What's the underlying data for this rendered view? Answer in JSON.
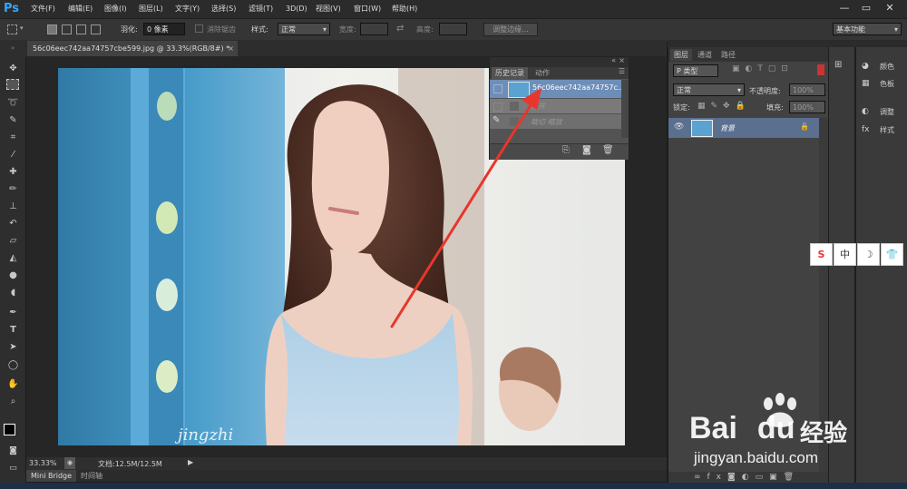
{
  "app": {
    "logo": "Ps"
  },
  "menu": [
    "文件(F)",
    "编辑(E)",
    "图像(I)",
    "图层(L)",
    "文字(Y)",
    "选择(S)",
    "滤镜(T)",
    "3D(D)",
    "视图(V)",
    "窗口(W)",
    "帮助(H)"
  ],
  "window_controls": {
    "minimize": "—",
    "restore": "▭",
    "close": "✕"
  },
  "options": {
    "feather_label": "羽化:",
    "feather_value": "0 像素",
    "antialias_label": "消除锯齿",
    "style_label": "样式:",
    "style_value": "正常",
    "width_label": "宽度:",
    "height_label": "高度:",
    "refine_button": "调整边缘...",
    "workspace": "基本功能"
  },
  "document": {
    "tab_title": "56c06eec742aa74757cbe599.jpg @ 33.3%(RGB/8#) *",
    "close": "×",
    "watermark": "jingzhi"
  },
  "status": {
    "zoom": "33.33%",
    "doc_info": "文档:12.5M/12.5M"
  },
  "bottom_tabs": [
    "Mini Bridge",
    "时间轴"
  ],
  "history": {
    "tabs": [
      "历史记录",
      "动作"
    ],
    "snapshot": "56c06eec742aa74757c...",
    "items": [
      "打开",
      "裁切 缩放"
    ]
  },
  "layers_panel": {
    "tabs": [
      "图层",
      "通道",
      "路径"
    ],
    "kind_filter": "P 类型",
    "blend_mode": "正常",
    "opacity_label": "不透明度:",
    "opacity_value": "100%",
    "lock_label": "锁定:",
    "fill_label": "填充:",
    "fill_value": "100%",
    "layer_name": "背景"
  },
  "adjust_panel": {
    "items": [
      "颜色",
      "色板",
      "调整",
      "样式"
    ]
  },
  "ime": [
    "S",
    "中",
    "☽",
    "👕"
  ],
  "baidu": {
    "brand": "Bai",
    "brand2": "du",
    "jingyan": "经验",
    "url": "jingyan.baidu.com"
  },
  "colors": {
    "accent": "#31a8ff",
    "arrow": "#e8362c",
    "panel": "#424242",
    "dark": "#2b2b2b"
  }
}
